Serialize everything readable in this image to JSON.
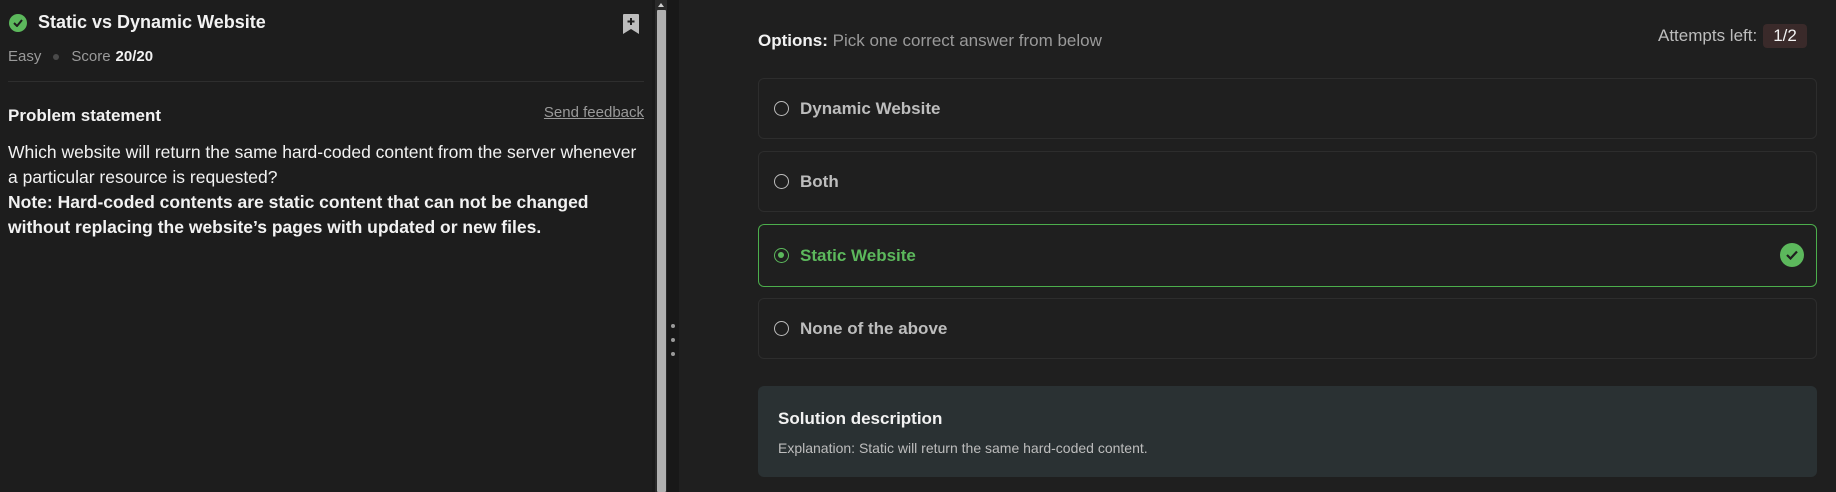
{
  "problem": {
    "title": "Static vs Dynamic Website",
    "difficulty": "Easy",
    "score_label": "Score",
    "score_value": "20/20",
    "statement_heading": "Problem statement",
    "feedback_link": "Send feedback",
    "question": "Which website will return the same hard-coded content from the server whenever a particular resource is requested?",
    "note": "Note: Hard-coded contents are static content that can not be changed without replacing the website’s pages with updated or new files."
  },
  "quiz": {
    "options_label": "Options:",
    "options_hint": "Pick one correct answer from below",
    "attempts_label": "Attempts left:",
    "attempts_value": "1/2",
    "options": [
      {
        "label": "Dynamic Website",
        "selected": false,
        "correct": false
      },
      {
        "label": "Both",
        "selected": false,
        "correct": false
      },
      {
        "label": "Static Website",
        "selected": true,
        "correct": true
      },
      {
        "label": "None of the above",
        "selected": false,
        "correct": false
      }
    ]
  },
  "solution": {
    "title": "Solution description",
    "text": "Explanation: Static will return the same hard-coded content."
  },
  "icons": {
    "status": "check-circle-icon",
    "bookmark": "bookmark-add-icon",
    "correct": "check-circle-icon"
  },
  "colors": {
    "accent_green": "#5cb85c",
    "background": "#1d1d1d",
    "solution_bg": "#2a3133"
  }
}
